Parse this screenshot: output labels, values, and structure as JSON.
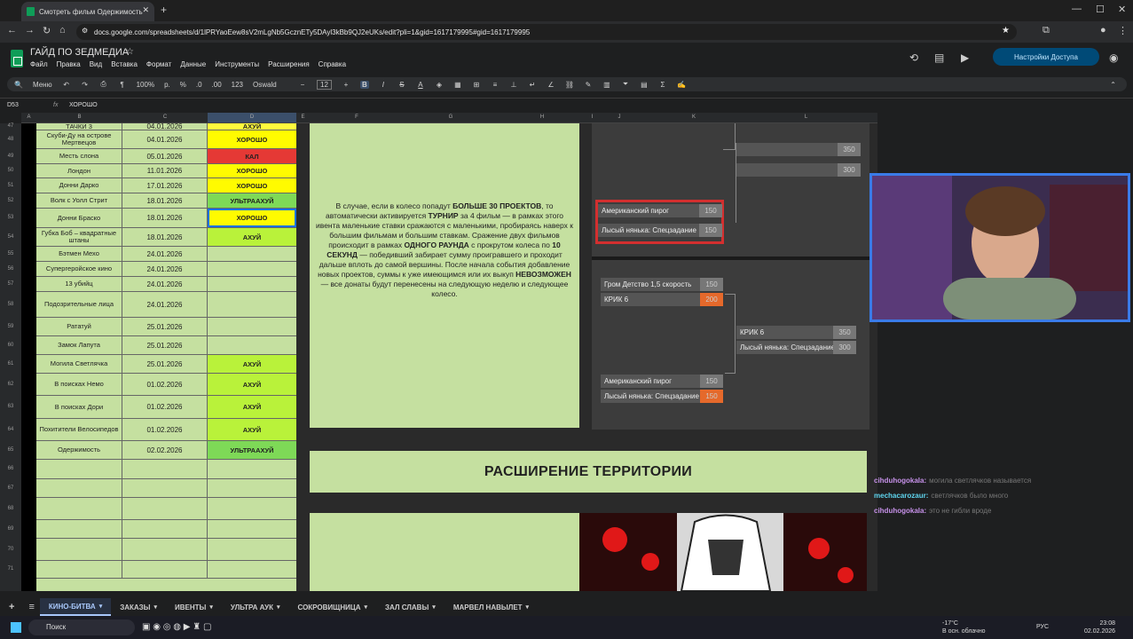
{
  "browser": {
    "tab_title": "Смотреть фильм Одержимость",
    "url": "docs.google.com/spreadsheets/d/1lPRYaoEew8sV2mLgNb5GcznETy5DAyl3kBb9QJ2eUKs/edit?pli=1&gid=1617179995#gid=1617179995"
  },
  "sheets": {
    "title": "ГАЙД ПО ЗЕДМЕДИА",
    "menus": [
      "Файл",
      "Правка",
      "Вид",
      "Вставка",
      "Формат",
      "Данные",
      "Инструменты",
      "Расширения",
      "Справка"
    ],
    "share_label": "Настройки Доступа",
    "toolbar": {
      "menu": "Меню",
      "zoom": "100%",
      "currency": "р.",
      "percent": "%",
      "dec_less": ".0",
      "dec_more": ".00",
      "numfmt": "123",
      "font": "Oswald",
      "font_size": "12"
    },
    "cell_ref": "D53",
    "formula_value": "ХОРОШО",
    "columns": [
      "A",
      "B",
      "C",
      "D",
      "E",
      "F",
      "G",
      "H",
      "I",
      "J",
      "K",
      "L"
    ],
    "rows": [
      {
        "num": "47",
        "name": "ТАЧКИ 3",
        "date": "04.01.2026",
        "rating": "АХУЙ",
        "color": "#fffb3d"
      },
      {
        "num": "48",
        "name": "Скуби-Ду на острове Мертвецов",
        "date": "04.01.2026",
        "rating": "ХОРОШО",
        "color": "#fffb00"
      },
      {
        "num": "49",
        "name": "Месть слона",
        "date": "05.01.2026",
        "rating": "КАЛ",
        "color": "#e53935"
      },
      {
        "num": "50",
        "name": "Лондон",
        "date": "11.01.2026",
        "rating": "ХОРОШО",
        "color": "#fffb00"
      },
      {
        "num": "51",
        "name": "Донни Дарко",
        "date": "17.01.2026",
        "rating": "ХОРОШО",
        "color": "#fffb00"
      },
      {
        "num": "52",
        "name": "Волк с Уолл Стрит",
        "date": "18.01.2026",
        "rating": "УЛЬТРААХУЙ",
        "color": "#7ed957"
      },
      {
        "num": "53",
        "name": "Донни Браско",
        "date": "18.01.2026",
        "rating": "ХОРОШО",
        "color": "#fffb00"
      },
      {
        "num": "54",
        "name": "Губка Боб – квадратные штаны",
        "date": "18.01.2026",
        "rating": "АХУЙ",
        "color": "#b9f23a"
      },
      {
        "num": "55",
        "name": "Бэтмен Мехо",
        "date": "24.01.2026",
        "rating": "",
        "color": ""
      },
      {
        "num": "56",
        "name": "Супергеройское кино",
        "date": "24.01.2026",
        "rating": "",
        "color": ""
      },
      {
        "num": "57",
        "name": "13 убийц",
        "date": "24.01.2026",
        "rating": "",
        "color": ""
      },
      {
        "num": "58",
        "name": "Подозрительные лица",
        "date": "24.01.2026",
        "rating": "",
        "color": ""
      },
      {
        "num": "59",
        "name": "Рататуй",
        "date": "25.01.2026",
        "rating": "",
        "color": ""
      },
      {
        "num": "60",
        "name": "Замок Лапута",
        "date": "25.01.2026",
        "rating": "",
        "color": ""
      },
      {
        "num": "61",
        "name": "Могила Светлячка",
        "date": "25.01.2026",
        "rating": "АХУЙ",
        "color": "#b9f23a"
      },
      {
        "num": "62",
        "name": "В поисках Немо",
        "date": "01.02.2026",
        "rating": "АХУЙ",
        "color": "#b9f23a"
      },
      {
        "num": "63",
        "name": "В поисках Дори",
        "date": "01.02.2026",
        "rating": "АХУЙ",
        "color": "#b9f23a"
      },
      {
        "num": "64",
        "name": "Похитители Велосипедов",
        "date": "01.02.2026",
        "rating": "АХУЙ",
        "color": "#b9f23a"
      },
      {
        "num": "65",
        "name": "Одержимость",
        "date": "02.02.2026",
        "rating": "УЛЬТРААХУЙ",
        "color": "#7ed957"
      },
      {
        "num": "66",
        "name": "",
        "date": "",
        "rating": "",
        "color": ""
      },
      {
        "num": "67",
        "name": "",
        "date": "",
        "rating": "",
        "color": ""
      },
      {
        "num": "68",
        "name": "",
        "date": "",
        "rating": "",
        "color": ""
      },
      {
        "num": "69",
        "name": "",
        "date": "",
        "rating": "",
        "color": ""
      },
      {
        "num": "70",
        "name": "",
        "date": "",
        "rating": "",
        "color": ""
      },
      {
        "num": "71",
        "name": "",
        "date": "",
        "rating": "",
        "color": ""
      }
    ],
    "description": {
      "p1": "В случае, если в колесо попадут ",
      "b1": "БОЛЬШЕ 30 ПРОЕКТОВ",
      "p2": ", то автоматически активируется ",
      "b2": "ТУРНИР",
      "p3": " за 4 фильм — в рамках этого ивента маленькие ставки сражаются с маленькими, пробираясь наверх к большим фильмам и большим ставкам. Сражение двух фильмов происходит в рамках ",
      "b3": "ОДНОГО РАУНДА",
      "p4": " с прокрутом колеса по ",
      "b4": "10 СЕКУНД",
      "p5": " — победивший забирает сумму проигравшего и проходит дальше вплоть до самой вершины. После начала события добавление новых проектов, суммы к уже имеющимся или их выкуп ",
      "b5": "НЕВОЗМОЖЕН",
      "p6": " — все донаты будут перенесены на следующую неделю и следующее колесо."
    },
    "bracket": {
      "top_vals": [
        "350",
        "300"
      ],
      "pair1": [
        {
          "name": "Американский пирог",
          "val": "150"
        },
        {
          "name": "Лысый нянька: Спецзадание",
          "val": "150"
        }
      ],
      "pair2": [
        {
          "name": "Гром Детство 1,5 скорость",
          "val": "150"
        },
        {
          "name": "КРИК 6",
          "val": "200"
        }
      ],
      "pair3": [
        {
          "name": "КРИК 6",
          "val": "350"
        },
        {
          "name": "Лысый нянька: Спецзадание",
          "val": "300"
        }
      ],
      "pair4": [
        {
          "name": "Американский пирог",
          "val": "150"
        },
        {
          "name": "Лысый нянька: Спецзадание",
          "val": "150"
        }
      ]
    },
    "extension_header": "РАСШИРЕНИЕ ТЕРРИТОРИИ",
    "sheet_tabs": [
      "КИНО-БИТВА",
      "ЗАКАЗЫ",
      "ИВЕНТЫ",
      "УЛЬТРА АУК",
      "СОКРОВИЩНИЦА",
      "ЗАЛ СЛАВЫ",
      "МАРВЕЛ НАВЫЛЕТ"
    ]
  },
  "chat": [
    {
      "user": "cihduhogokala:",
      "msg": "могила светлячков называется",
      "color": "#c792ea"
    },
    {
      "user": "mechacarozaur:",
      "msg": "светлячков было много",
      "color": "#5fd6f0"
    },
    {
      "user": "cihduhogokala:",
      "msg": "это не гибли вроде",
      "color": "#c792ea"
    }
  ],
  "taskbar": {
    "search": "Поиск",
    "weather_temp": "-17°C",
    "weather_desc": "В осн. облачно",
    "lang": "РУС",
    "time": "23:08",
    "date": "02.02.2026"
  }
}
